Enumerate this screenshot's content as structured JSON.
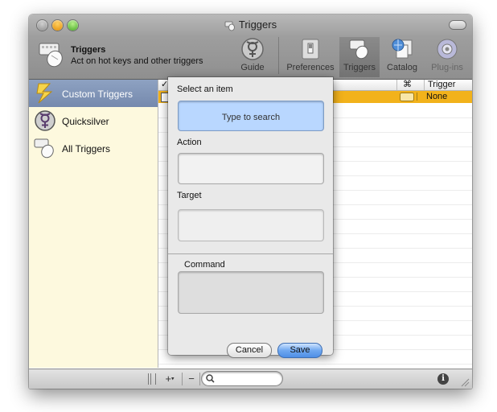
{
  "window": {
    "title": "Triggers"
  },
  "app": {
    "name": "Triggers",
    "description": "Act on hot keys and other triggers"
  },
  "toolbar": {
    "items": [
      {
        "label": "Guide",
        "icon": "quicksilver-logo-icon"
      },
      {
        "label": "Preferences",
        "icon": "switch-icon"
      },
      {
        "label": "Triggers",
        "icon": "trigger-keyboard-mouse-icon",
        "active": true
      },
      {
        "label": "Catalog",
        "icon": "globe-documents-icon"
      },
      {
        "label": "Plug-ins",
        "icon": "gear-icon"
      }
    ]
  },
  "sidebar": {
    "items": [
      {
        "label": "Custom Triggers",
        "icon": "lightning-icon",
        "selected": true
      },
      {
        "label": "Quicksilver",
        "icon": "quicksilver-logo-icon"
      },
      {
        "label": "All Triggers",
        "icon": "trigger-keyboard-mouse-icon"
      }
    ]
  },
  "table": {
    "columns": {
      "enabled": "✓",
      "command_symbol": "⌘",
      "trigger": "Trigger"
    },
    "selected_row": {
      "trigger": "None"
    }
  },
  "panel": {
    "select_label": "Select an item",
    "search_placeholder": "Type to search",
    "action_label": "Action",
    "target_label": "Target",
    "command_label": "Command",
    "cancel_label": "Cancel",
    "save_label": "Save"
  },
  "bottombar": {
    "add_label": "+",
    "remove_label": "−",
    "info_label": "i"
  },
  "colors": {
    "selection_orange": "#f2b21b",
    "sidebar_bg": "#fdf9de",
    "search_highlight": "#b9d7ff"
  }
}
